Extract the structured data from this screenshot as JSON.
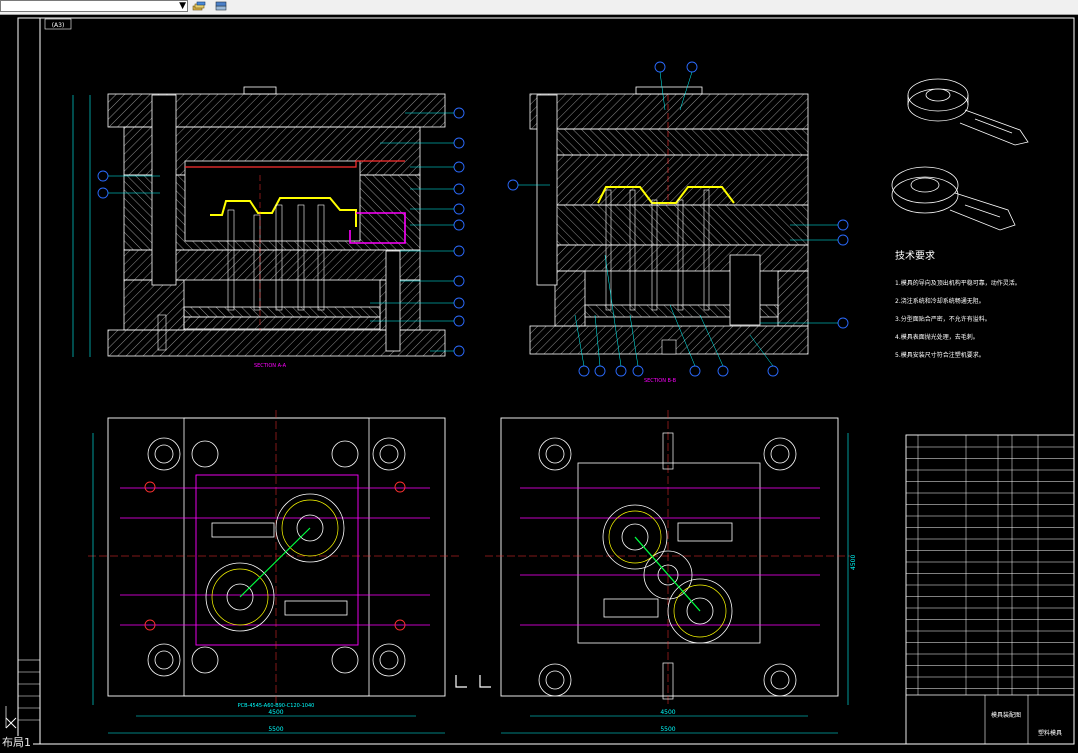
{
  "toolbar": {
    "layer_combo_value": "",
    "icons": [
      "layer-states-icon",
      "layer-previous-icon"
    ]
  },
  "drawing": {
    "title_stamp": "(A3)",
    "section_labels": [
      "SECTION A-A",
      "SECTION B-B"
    ],
    "tech_title": "技术要求",
    "tech_lines": [
      "1.模具的导向及顶出机构平稳可靠，动作灵活。",
      "2.浇注系统和冷却系统畅通无阻。",
      "3.分型面贴合严密，不允许有溢料。",
      "4.模具表面抛光处理，去毛刺。",
      "5.模具安装尺寸符合注塑机要求。"
    ],
    "dimensions": {
      "plan_left_width": "5500",
      "plan_left_inner": "4500",
      "plan_right_width": "5500",
      "plan_right_inner": "4500",
      "plan_height": "4500",
      "pcb_label": "PCB-4545-A60-B90-C120-1040"
    },
    "title_block": {
      "drawing_name": "模具装配图",
      "company": "塑料模具"
    },
    "colors": {
      "frame": "#ffffff",
      "hatch": "#ffffff",
      "accent_magenta": "#ff00ff",
      "accent_cyan": "#00ffff",
      "accent_yellow": "#ffff00",
      "accent_red": "#ff3030",
      "accent_blue": "#2b6bff",
      "accent_green": "#00ff40"
    }
  },
  "status": {
    "layout_tab": "布局1"
  }
}
